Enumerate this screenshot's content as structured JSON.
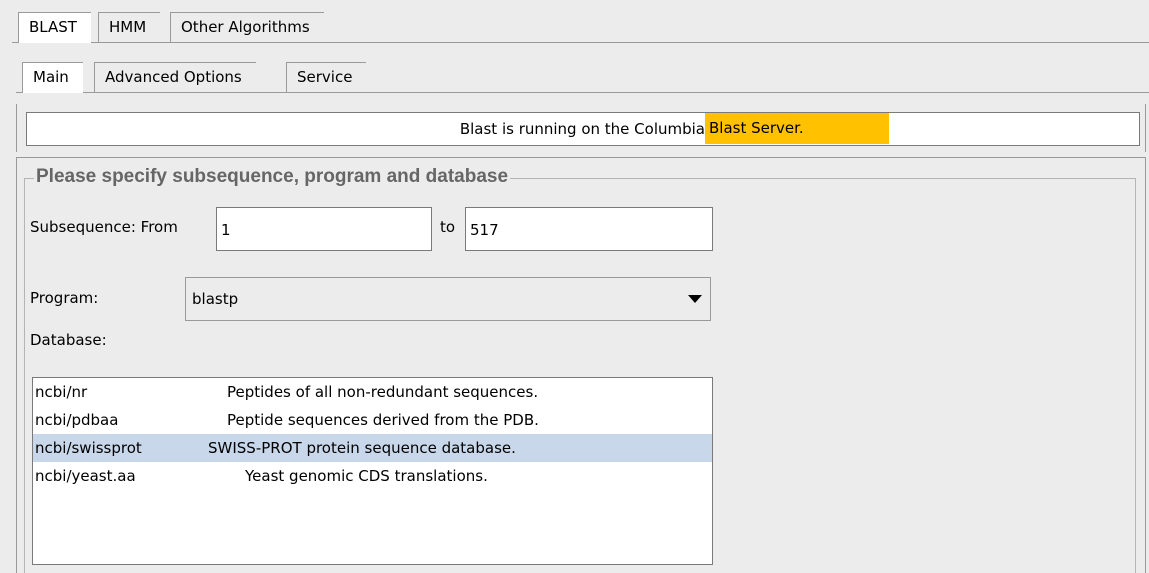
{
  "tabs_top": [
    "BLAST",
    "HMM",
    "Other Algorithms"
  ],
  "tabs_sub": [
    "Main",
    "Advanced Options",
    "Service"
  ],
  "status": {
    "text_before": "Blast is running on the Columbia ",
    "text_highlight": "Blast Server.",
    "highlight_color": "#ffc100"
  },
  "group": {
    "title": "Please specify subsequence, program and database"
  },
  "subsequence": {
    "label": "Subsequence: From",
    "from": "1",
    "to_label": "to",
    "to": "517"
  },
  "program": {
    "label": "Program:",
    "value": "blastp"
  },
  "database": {
    "label": "Database:",
    "items": [
      {
        "name": "ncbi/nr",
        "desc": "Peptides of all non-redundant sequences."
      },
      {
        "name": "ncbi/pdbaa",
        "desc": "Peptide sequences  derived from the PDB."
      },
      {
        "name": "ncbi/swissprot",
        "desc": "SWISS-PROT protein sequence database."
      },
      {
        "name": "ncbi/yeast.aa",
        "desc": "Yeast  genomic CDS translations."
      }
    ],
    "selected_index": 2
  }
}
